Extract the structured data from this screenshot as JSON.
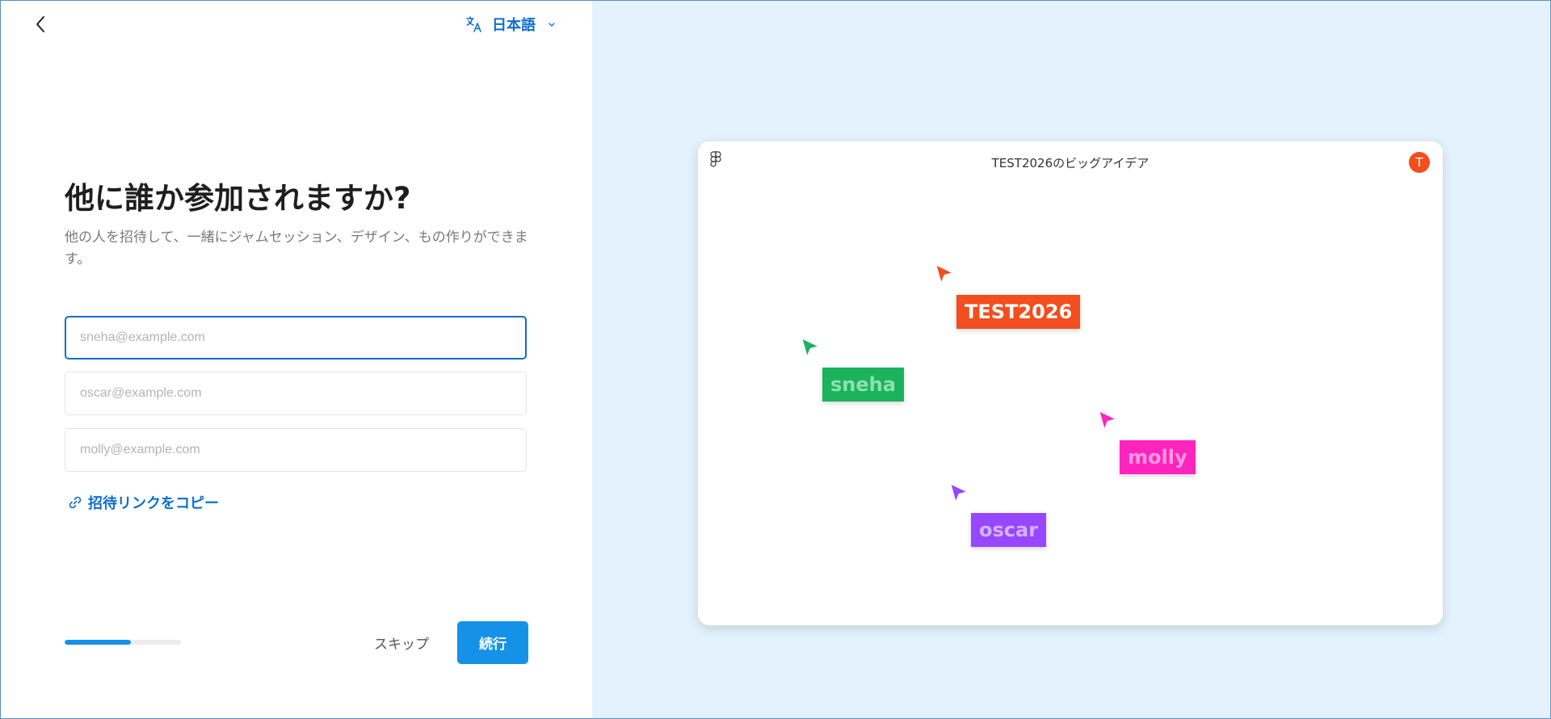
{
  "header": {
    "language": "日本語"
  },
  "main": {
    "heading": "他に誰か参加されますか?",
    "description": "他の人を招待して、一緒にジャムセッション、デザイン、もの作りができます。",
    "fields": [
      {
        "placeholder": "sneha@example.com",
        "value": ""
      },
      {
        "placeholder": "oscar@example.com",
        "value": ""
      },
      {
        "placeholder": "molly@example.com",
        "value": ""
      }
    ],
    "copy_link_label": "招待リンクをコピー"
  },
  "footer": {
    "progress_fraction": 0.57,
    "skip_label": "スキップ",
    "continue_label": "続行"
  },
  "preview": {
    "title": "TEST2026のビッグアイデア",
    "avatar_initial": "T",
    "collaborators": [
      {
        "name": "TEST2026",
        "color": "#f24e1e",
        "text_color": "#ffffff"
      },
      {
        "name": "sneha",
        "color": "#1bb35c",
        "text_color": "#8fe0b0"
      },
      {
        "name": "molly",
        "color": "#ff24bd",
        "text_color": "#ff9ae0"
      },
      {
        "name": "oscar",
        "color": "#9747ff",
        "text_color": "#d2b3ff"
      }
    ]
  },
  "colors": {
    "accent": "#0d6fd0",
    "primary_button": "#1592e8",
    "preview_background": "#e3f2fd"
  }
}
